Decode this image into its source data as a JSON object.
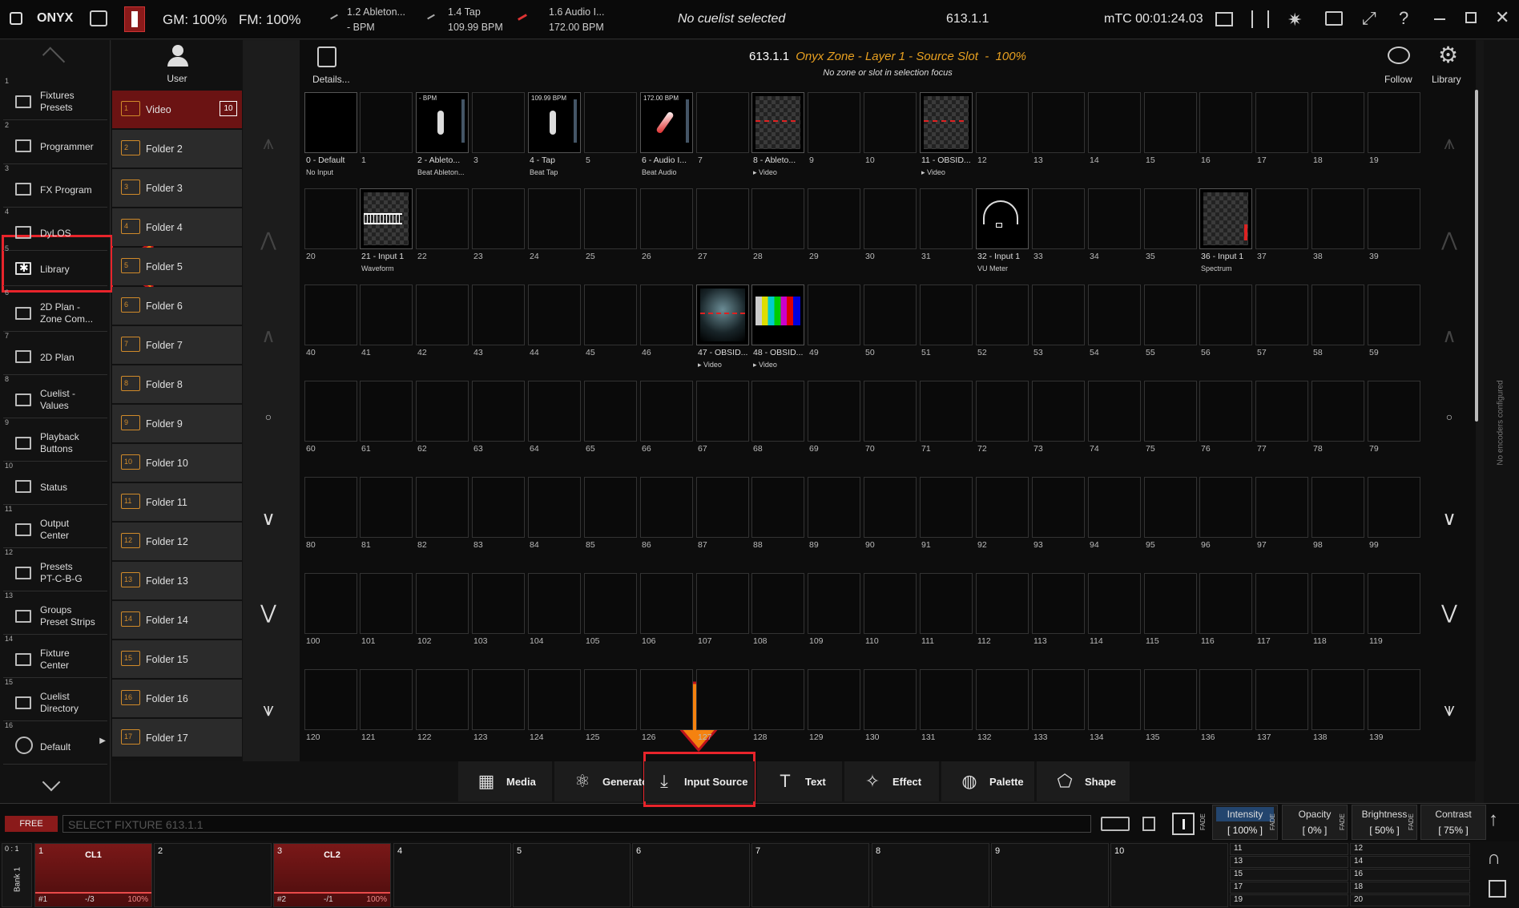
{
  "app": {
    "logo": "ONYX",
    "gm": "GM: 100%",
    "fm": "FM: 100%",
    "no_cuelist": "No cuelist selected",
    "cue_id": "613.1.1",
    "mtc": "mTC 00:01:24.03"
  },
  "sources": [
    {
      "name": "1.2 Ableton...",
      "value": "- BPM"
    },
    {
      "name": "1.4 Tap",
      "value": "109.99 BPM"
    },
    {
      "name": "1.6 Audio I...",
      "value": "172.00 BPM"
    }
  ],
  "left_nav": [
    {
      "num": "1",
      "label": "Fixtures\nPresets"
    },
    {
      "num": "2",
      "label": "Programmer"
    },
    {
      "num": "3",
      "label": "FX Program"
    },
    {
      "num": "4",
      "label": "DyLOS"
    },
    {
      "num": "5",
      "label": "Library"
    },
    {
      "num": "6",
      "label": "2D Plan -\nZone Com..."
    },
    {
      "num": "7",
      "label": "2D Plan"
    },
    {
      "num": "8",
      "label": "Cuelist -\nValues"
    },
    {
      "num": "9",
      "label": "Playback\nButtons"
    },
    {
      "num": "10",
      "label": "Status"
    },
    {
      "num": "11",
      "label": "Output\nCenter"
    },
    {
      "num": "12",
      "label": "Presets\nPT-C-B-G"
    },
    {
      "num": "13",
      "label": "Groups\nPreset Strips"
    },
    {
      "num": "14",
      "label": "Fixture\nCenter"
    },
    {
      "num": "15",
      "label": "Cuelist\nDirectory"
    },
    {
      "num": "16",
      "label": "Default"
    }
  ],
  "user_label": "User",
  "folders": [
    {
      "num": "1",
      "label": "Video",
      "badge": "10"
    },
    {
      "num": "2",
      "label": "Folder 2"
    },
    {
      "num": "3",
      "label": "Folder 3"
    },
    {
      "num": "4",
      "label": "Folder 4"
    },
    {
      "num": "5",
      "label": "Folder 5"
    },
    {
      "num": "6",
      "label": "Folder 6"
    },
    {
      "num": "7",
      "label": "Folder 7"
    },
    {
      "num": "8",
      "label": "Folder 8"
    },
    {
      "num": "9",
      "label": "Folder 9"
    },
    {
      "num": "10",
      "label": "Folder 10"
    },
    {
      "num": "11",
      "label": "Folder 11"
    },
    {
      "num": "12",
      "label": "Folder 12"
    },
    {
      "num": "13",
      "label": "Folder 13"
    },
    {
      "num": "14",
      "label": "Folder 14"
    },
    {
      "num": "15",
      "label": "Folder 15"
    },
    {
      "num": "16",
      "label": "Folder 16"
    },
    {
      "num": "17",
      "label": "Folder 17"
    }
  ],
  "header": {
    "details": "Details...",
    "title_id": "613.1.1",
    "title_name": "Onyx Zone - Layer 1 - Source Slot",
    "title_pct": "100%",
    "subtitle": "No zone or slot in selection focus",
    "follow": "Follow",
    "library": "Library"
  },
  "slots": [
    {
      "n": 0,
      "label": "0 - Default",
      "sub": "No Input",
      "type": "default"
    },
    {
      "n": 2,
      "label": "2 - Ableto...",
      "sub": "Beat  Ableton...",
      "type": "beat",
      "ttl": "- BPM"
    },
    {
      "n": 4,
      "label": "4 - Tap",
      "sub": "Beat Tap",
      "type": "beat",
      "ttl": "109.99 BPM"
    },
    {
      "n": 6,
      "label": "6 - Audio I...",
      "sub": "Beat Audio",
      "type": "beat",
      "ttl": "172.00 BPM"
    },
    {
      "n": 8,
      "label": "8 - Ableto...",
      "sub": "▸ Video",
      "type": "video"
    },
    {
      "n": 11,
      "label": "11 - OBSID...",
      "sub": "▸ Video",
      "type": "video"
    },
    {
      "n": 21,
      "label": "21 - Input 1",
      "sub": "Waveform",
      "type": "wave"
    },
    {
      "n": 32,
      "label": "32 - Input 1",
      "sub": "VU Meter",
      "type": "vu"
    },
    {
      "n": 36,
      "label": "36 - Input 1",
      "sub": "Spectrum",
      "type": "spectrum"
    },
    {
      "n": 47,
      "label": "47 - OBSID...",
      "sub": "▸ Video",
      "type": "obs"
    },
    {
      "n": 48,
      "label": "48 - OBSID...",
      "sub": "▸ Video",
      "type": "bars"
    }
  ],
  "bottom_tabs": [
    {
      "label": "Media",
      "icon": "media-icon"
    },
    {
      "label": "Generator",
      "icon": "atom-icon"
    },
    {
      "label": "Input Source",
      "icon": "input-source-icon"
    },
    {
      "label": "Text",
      "icon": "text-icon"
    },
    {
      "label": "Effect",
      "icon": "magic-wand-icon"
    },
    {
      "label": "Palette",
      "icon": "palette-icon"
    },
    {
      "label": "Shape",
      "icon": "shape-icon"
    }
  ],
  "cmd": {
    "free": "FREE",
    "placeholder": "SELECT FIXTURE 613.1.1"
  },
  "params": [
    {
      "name": "Intensity",
      "value": "[ 100% ]",
      "fade": "FADE"
    },
    {
      "name": "Opacity",
      "value": "[ 0% ]",
      "fade": "FADE"
    },
    {
      "name": "Brightness",
      "value": "[ 50% ]",
      "fade": "FADE"
    },
    {
      "name": "Contrast",
      "value": "[ 75% ]",
      "fade": "FADE"
    }
  ],
  "side_text": "No encoders configured",
  "playback": {
    "bank_top": "0 : 1",
    "bank": "Bank 1",
    "faders": [
      {
        "num": "1",
        "label": "CL1",
        "id": "#1",
        "cue": "-/3",
        "pct": "100%"
      },
      {
        "num": "2"
      },
      {
        "num": "3",
        "label": "CL2",
        "id": "#2",
        "cue": "-/1",
        "pct": "100%"
      },
      {
        "num": "4"
      },
      {
        "num": "5"
      },
      {
        "num": "6"
      },
      {
        "num": "7"
      },
      {
        "num": "8"
      },
      {
        "num": "9"
      },
      {
        "num": "10"
      }
    ],
    "mini_left": [
      "11",
      "13",
      "15",
      "17",
      "19"
    ],
    "mini_right": [
      "12",
      "14",
      "16",
      "18",
      "20"
    ]
  }
}
